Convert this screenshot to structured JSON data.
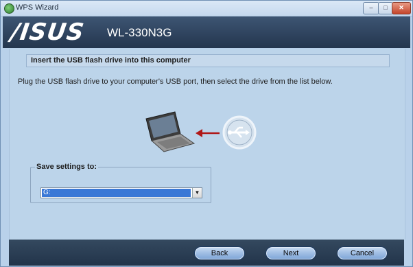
{
  "window": {
    "title": "WPS Wizard",
    "controls": {
      "minimize": "–",
      "maximize": "□",
      "close": "✕"
    }
  },
  "banner": {
    "logo": "/ISUS",
    "model": "WL-330N3G"
  },
  "step": {
    "heading": "Insert the USB flash drive into this computer",
    "instruction": "Plug the USB flash drive to your computer's USB port, then select the drive from the list below."
  },
  "illustration": {
    "laptop_icon": "laptop-icon",
    "arrow_icon": "arrow-left-icon",
    "usb_icon": "usb-icon",
    "arrow_color": "#b01818"
  },
  "save_settings": {
    "label": "Save settings to:",
    "selected": "G:"
  },
  "buttons": {
    "back": "Back",
    "next": "Next",
    "cancel": "Cancel"
  },
  "colors": {
    "banner": "#2b3f59",
    "content": "#bcd4ea",
    "button": "#9fbde4"
  }
}
